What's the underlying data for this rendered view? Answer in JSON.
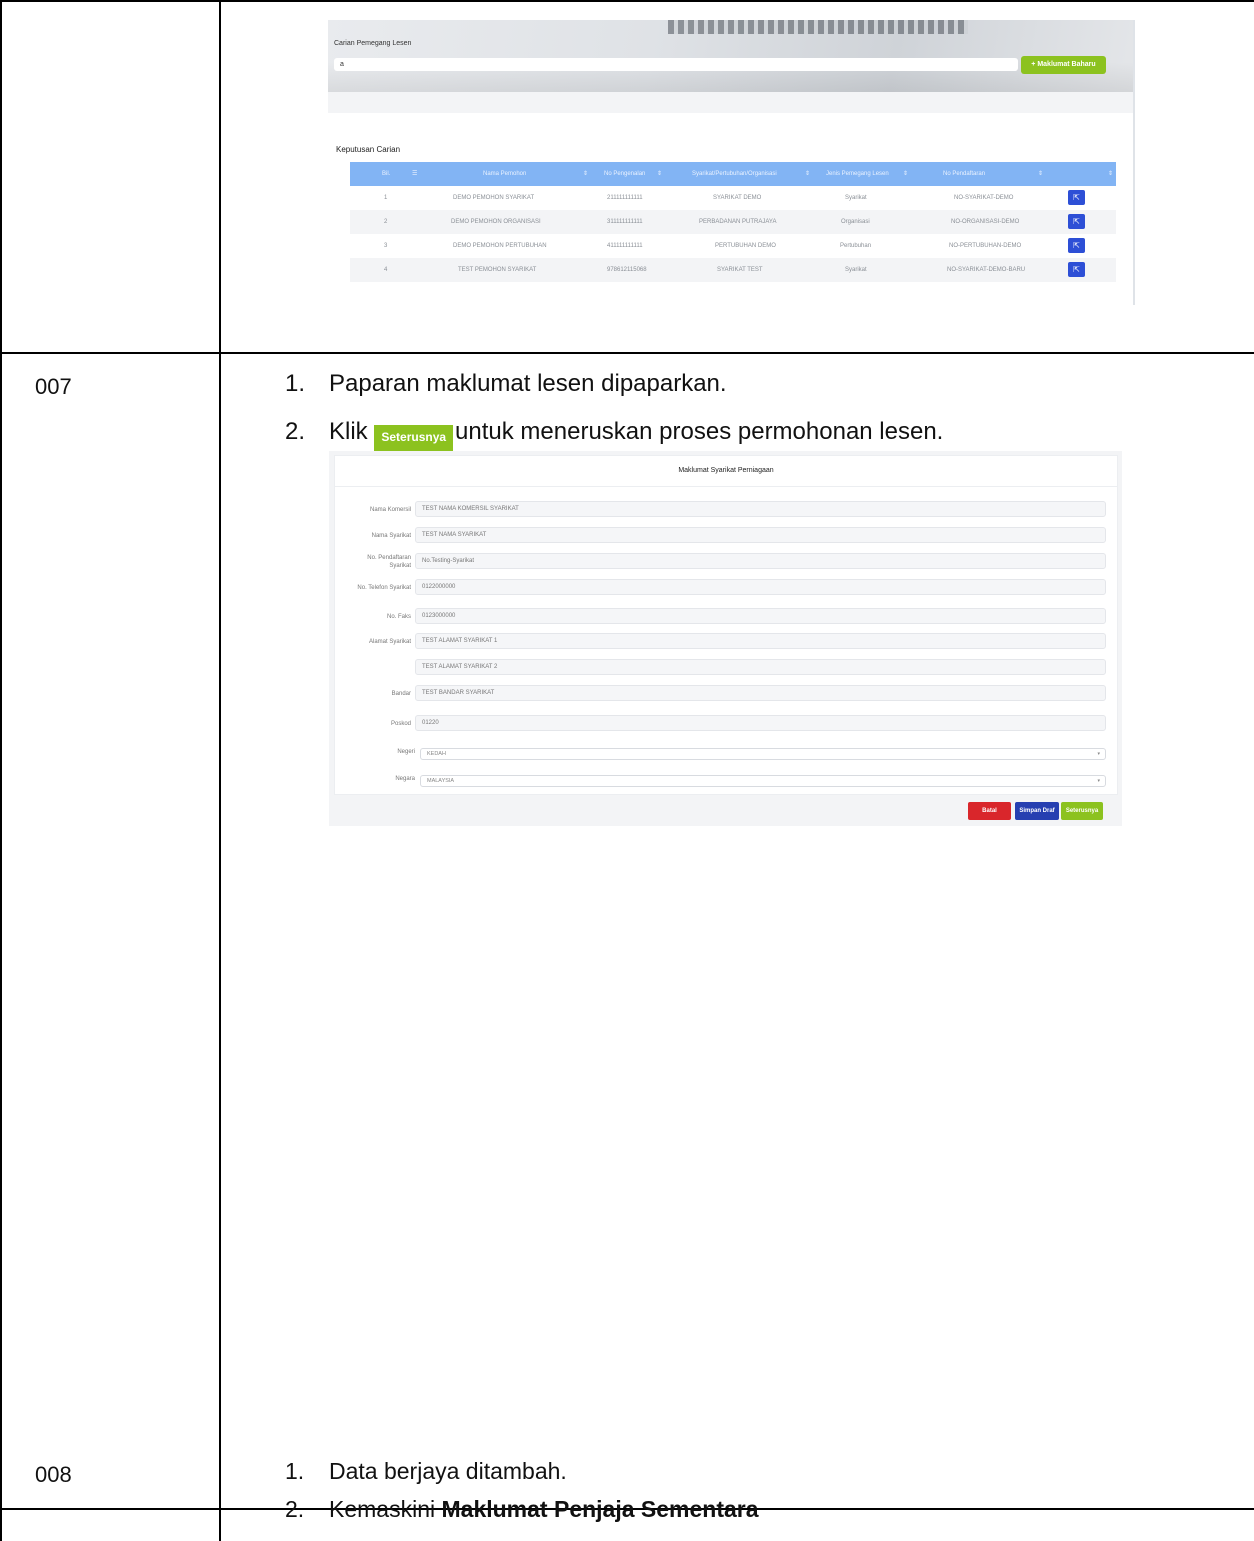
{
  "rows": [
    {
      "num": "007"
    },
    {
      "num": "008"
    }
  ],
  "screenshot1": {
    "search_label": "Carian Pemegang Lesen",
    "search_value": "a",
    "new_button": "+ Maklumat Baharu",
    "results_title": "Keputusan Carian",
    "columns": [
      "Bil.",
      "Nama Pemohon",
      "No Pengenalan",
      "Syarikat/Pertubuhan/Organisasi",
      "Jenis Pemegang Lesen",
      "No Pendaftaran"
    ],
    "table_rows": [
      [
        "1",
        "DEMO PEMOHON SYARIKAT",
        "211111111111",
        "SYARIKAT DEMO",
        "Syarikat",
        "NO-SYARIKAT-DEMO"
      ],
      [
        "2",
        "DEMO PEMOHON ORGANISASI",
        "311111111111",
        "PERBADANAN PUTRAJAYA",
        "Organisasi",
        "NO-ORGANISASI-DEMO"
      ],
      [
        "3",
        "DEMO PEMOHON PERTUBUHAN",
        "411111111111",
        "PERTUBUHAN DEMO",
        "Pertubuhan",
        "NO-PERTUBUHAN-DEMO"
      ],
      [
        "4",
        "TEST PEMOHON SYARIKAT",
        "978612115068",
        "SYARIKAT TEST",
        "Syarikat",
        "NO-SYARIKAT-DEMO-BARU"
      ]
    ]
  },
  "step007": {
    "item1": "Paparan maklumat lesen dipaparkan.",
    "item2_prefix": "Klik",
    "item2_button": "Seterusnya",
    "item2_suffix": "untuk meneruskan proses permohonan lesen."
  },
  "screenshot2": {
    "title": "Maklumat Syarikat Perniagaan",
    "fields": {
      "nama_komersil_label": "Nama Komersil",
      "nama_komersil": "TEST NAMA KOMERSIL SYARIKAT",
      "nama_syarikat_label": "Nama Syarikat",
      "nama_syarikat": "TEST NAMA SYARIKAT",
      "no_pendaftaran_label_1": "No. Pendaftaran",
      "no_pendaftaran_label_2": "Syarikat",
      "no_pendaftaran": "No.Testing-Syarikat",
      "no_telefon_label": "No. Telefon Syarikat",
      "no_telefon": "0122000000",
      "no_faks_label": "No. Faks",
      "no_faks": "0123000000",
      "alamat_label": "Alamat Syarikat",
      "alamat_1": "TEST ALAMAT SYARIKAT 1",
      "alamat_2": "TEST ALAMAT SYARIKAT 2",
      "bandar_label": "Bandar",
      "bandar": "TEST BANDAR SYARIKAT",
      "poskod_label": "Poskod",
      "poskod": "01220",
      "negeri_label": "Negeri",
      "negeri": "KEDAH",
      "negara_label": "Negara",
      "negara": "MALAYSIA"
    },
    "buttons": {
      "batal": "Batal",
      "simpan": "Simpan Draf",
      "seterusnya": "Seterusnya"
    }
  },
  "step008": {
    "item1": "Data berjaya ditambah.",
    "item2_prefix": "Kemaskini",
    "item2_bold": "Maklumat Penjaja Sementara"
  },
  "colors": {
    "green": "#8cc21f",
    "blue_header": "#82b4f4",
    "action_blue": "#2d4fd6",
    "batal_red": "#d9262b",
    "simpan_blue": "#263fb1"
  }
}
